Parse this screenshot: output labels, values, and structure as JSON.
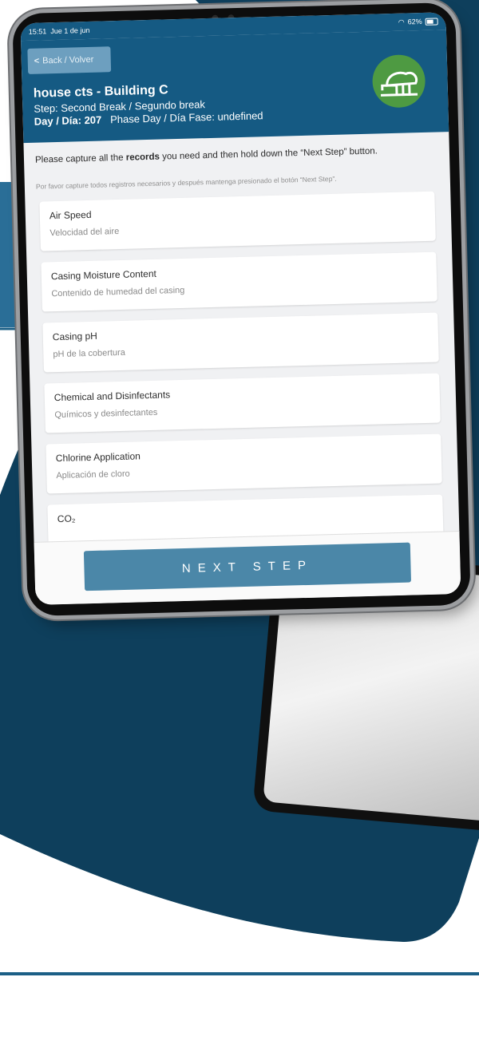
{
  "status_bar": {
    "time": "15:51",
    "date": "Jue 1 de jun",
    "battery": "62%"
  },
  "header": {
    "back_label": "Back / Volver",
    "title": "house cts - Building C",
    "step": "Step: Second Break / Segundo break",
    "day_label": "Day / Día: 207",
    "phase": "Phase Day / Día Fase: undefined",
    "logo_icon": "mushroom-icon"
  },
  "instructions": {
    "en_pre": "Please capture all the ",
    "en_bold": "records",
    "en_post": " you need and then hold down the “Next Step” button.",
    "es": "Por favor capture todos registros necesarios y después mantenga presionado el botón “Next Step”."
  },
  "records": [
    {
      "en": "Air Speed",
      "es": "Velocidad del aire"
    },
    {
      "en": "Casing Moisture Content",
      "es": "Contenido de humedad del casing"
    },
    {
      "en": "Casing pH",
      "es": "pH de la cobertura"
    },
    {
      "en": "Chemical and Disinfectants",
      "es": "Químicos y desinfectantes"
    },
    {
      "en": "Chlorine Application",
      "es": "Aplicación de cloro"
    },
    {
      "en": "CO₂",
      "es": ""
    }
  ],
  "next_label": "NEXT STEP",
  "colors": {
    "primary": "#155a83",
    "background_navy": "#0e3f5c",
    "logo_green": "#4e9a42",
    "button": "#4b87a8"
  }
}
